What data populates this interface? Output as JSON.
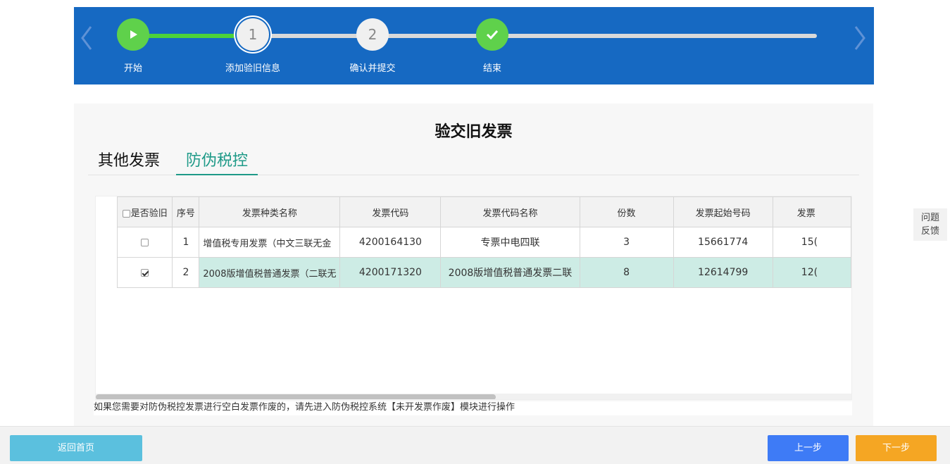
{
  "stepper": {
    "steps": [
      {
        "label": "开始",
        "marker": "play-icon"
      },
      {
        "label": "添加验旧信息",
        "marker": "1"
      },
      {
        "label": "确认并提交",
        "marker": "2"
      },
      {
        "label": "结束",
        "marker": "check-icon"
      }
    ],
    "colors": {
      "banner": "#1669c2",
      "done": "#5fd14b",
      "pending": "#f0f0f0"
    }
  },
  "panel": {
    "title": "验交旧发票",
    "tabs": [
      {
        "label": "其他发票",
        "active": false
      },
      {
        "label": "防伪税控",
        "active": true
      }
    ]
  },
  "table": {
    "columns": [
      "是否验旧",
      "序号",
      "发票种类名称",
      "发票代码",
      "发票代码名称",
      "份数",
      "发票起始号码",
      "发票"
    ],
    "rows": [
      {
        "checked": false,
        "no": "1",
        "type_name": "增值税专用发票（中文三联无金",
        "code": "4200164130",
        "code_name": "专票中电四联",
        "count": "3",
        "start_no": "15661774",
        "end_no_partial": "15("
      },
      {
        "checked": true,
        "no": "2",
        "type_name": "2008版增值税普通发票（二联无",
        "code": "4200171320",
        "code_name": "2008版增值税普通发票二联",
        "count": "8",
        "start_no": "12614799",
        "end_no_partial": "12("
      }
    ]
  },
  "hint": "如果您需要对防伪税控发票进行空白发票作废的，请先进入防伪税控系统【未开发票作废】模块进行操作",
  "feedback": {
    "line1": "问题",
    "line2": "反馈"
  },
  "footer": {
    "home_label": "返回首页",
    "prev_label": "上一步",
    "next_label": "下一步",
    "colors": {
      "home": "#5bc0de",
      "prev": "#3e7bf6",
      "next": "#f5a623"
    }
  }
}
